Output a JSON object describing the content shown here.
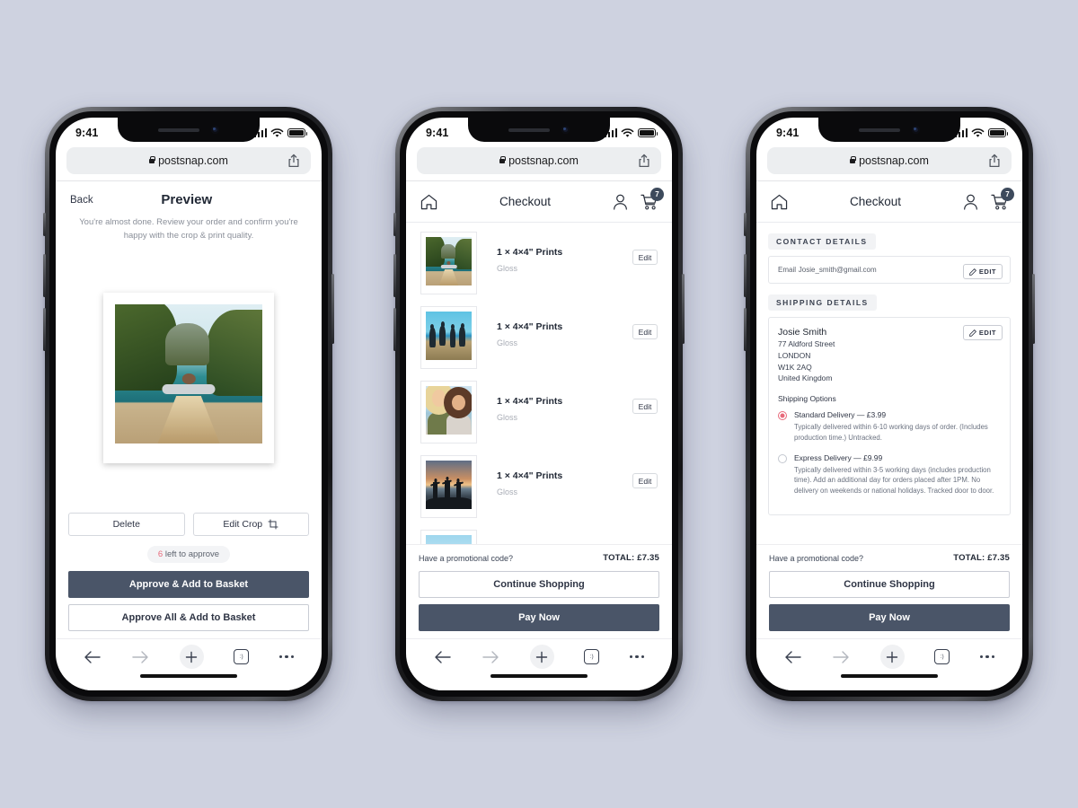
{
  "page": {
    "background": "#ced2e0",
    "accent_dark": "#4a5568",
    "accent_pink": "#e8697a"
  },
  "status_bar": {
    "time": "9:41",
    "signal_icon": "cellular-bars-icon",
    "wifi_icon": "wifi-icon",
    "battery_icon": "battery-icon"
  },
  "browser": {
    "url": "postsnap.com",
    "lock_icon": "lock-icon",
    "share_icon": "share-icon"
  },
  "safari_toolbar": {
    "back_icon": "arrow-left-icon",
    "forward_icon": "arrow-right-icon",
    "new_tab_icon": "plus-icon",
    "tabs_icon": "tabs-icon",
    "tabs_glyph": ":)",
    "more_icon": "more-dots-icon"
  },
  "phone1": {
    "back_label": "Back",
    "title": "Preview",
    "subtitle": "You're almost done. Review your order and confirm you're happy with the crop & print quality.",
    "photo": {
      "name": "lagoon-boat-photo",
      "alt": "Woman sitting on longtail boat in a lagoon"
    },
    "delete_label": "Delete",
    "edit_crop_label": "Edit Crop",
    "crop_icon": "crop-icon",
    "approve_chip_count": "6",
    "approve_chip_text": " left to approve",
    "approve_label": "Approve & Add to Basket",
    "approve_all_label": "Approve All & Add to Basket"
  },
  "phone2": {
    "header": {
      "home_icon": "home-icon",
      "title": "Checkout",
      "account_icon": "person-icon",
      "cart_icon": "cart-icon",
      "cart_badge": "7"
    },
    "items": [
      {
        "thumb": "lagoon-boat-photo",
        "name": "1 × 4×4\" Prints",
        "finish": "Gloss",
        "edit_label": "Edit"
      },
      {
        "thumb": "beach-jump-photo",
        "name": "1 × 4×4\" Prints",
        "finish": "Gloss",
        "edit_label": "Edit"
      },
      {
        "thumb": "two-friends-photo",
        "name": "1 × 4×4\" Prints",
        "finish": "Gloss",
        "edit_label": "Edit"
      },
      {
        "thumb": "sunset-silhouette-photo",
        "name": "1 × 4×4\" Prints",
        "finish": "Gloss",
        "edit_label": "Edit"
      },
      {
        "thumb": "cityscape-photo",
        "name": "",
        "finish": "",
        "edit_label": ""
      }
    ],
    "footer": {
      "promo_label": "Have a promotional code?",
      "total_label": "TOTAL: £7.35",
      "continue_label": "Continue Shopping",
      "pay_label": "Pay Now"
    }
  },
  "phone3": {
    "header": {
      "home_icon": "home-icon",
      "title": "Checkout",
      "account_icon": "person-icon",
      "cart_icon": "cart-icon",
      "cart_badge": "7"
    },
    "contact": {
      "section_label": "CONTACT DETAILS",
      "field_label": "Email",
      "value": "Josie_smith@gmail.com",
      "edit_label": "EDIT",
      "edit_icon": "pencil-icon"
    },
    "shipping": {
      "section_label": "SHIPPING DETAILS",
      "edit_label": "EDIT",
      "edit_icon": "pencil-icon",
      "name": "Josie Smith",
      "address_lines": [
        "77 Aldford Street",
        "LONDON",
        "W1K 2AQ",
        "United Kingdom"
      ],
      "options_title": "Shipping Options",
      "options": [
        {
          "selected": true,
          "name": "Standard Delivery — £3.99",
          "desc": "Typically delivered within 6-10 working days of order. (Includes production time.) Untracked."
        },
        {
          "selected": false,
          "name": "Express Delivery — £9.99",
          "desc": "Typically delivered within 3-5 working days (includes production time). Add an additional day for orders placed after 1PM. No delivery on weekends or national holidays. Tracked door to door."
        }
      ]
    },
    "footer": {
      "promo_label": "Have a promotional code?",
      "total_label": "TOTAL: £7.35",
      "continue_label": "Continue Shopping",
      "pay_label": "Pay Now"
    }
  }
}
